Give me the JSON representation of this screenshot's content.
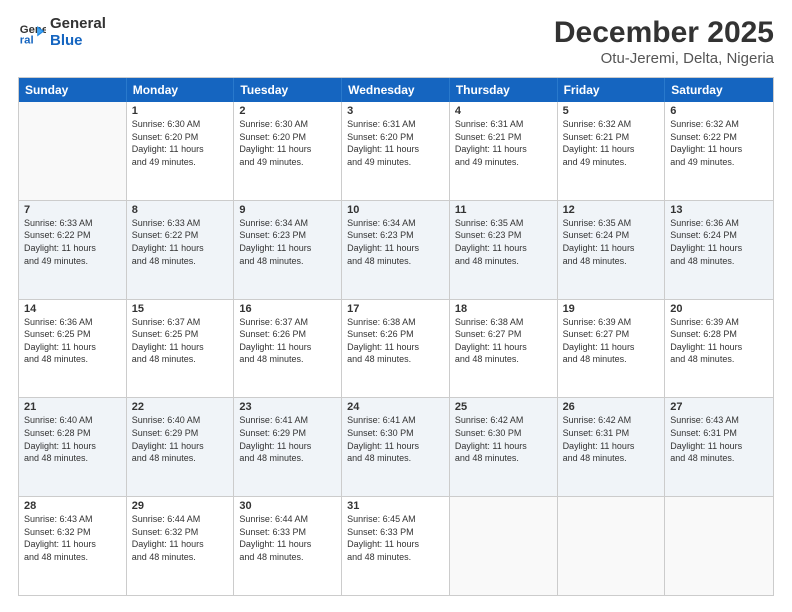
{
  "logo": {
    "text1": "General",
    "text2": "Blue"
  },
  "title": "December 2025",
  "subtitle": "Otu-Jeremi, Delta, Nigeria",
  "days": [
    "Sunday",
    "Monday",
    "Tuesday",
    "Wednesday",
    "Thursday",
    "Friday",
    "Saturday"
  ],
  "weeks": [
    [
      {
        "num": "",
        "lines": []
      },
      {
        "num": "1",
        "lines": [
          "Sunrise: 6:30 AM",
          "Sunset: 6:20 PM",
          "Daylight: 11 hours",
          "and 49 minutes."
        ]
      },
      {
        "num": "2",
        "lines": [
          "Sunrise: 6:30 AM",
          "Sunset: 6:20 PM",
          "Daylight: 11 hours",
          "and 49 minutes."
        ]
      },
      {
        "num": "3",
        "lines": [
          "Sunrise: 6:31 AM",
          "Sunset: 6:20 PM",
          "Daylight: 11 hours",
          "and 49 minutes."
        ]
      },
      {
        "num": "4",
        "lines": [
          "Sunrise: 6:31 AM",
          "Sunset: 6:21 PM",
          "Daylight: 11 hours",
          "and 49 minutes."
        ]
      },
      {
        "num": "5",
        "lines": [
          "Sunrise: 6:32 AM",
          "Sunset: 6:21 PM",
          "Daylight: 11 hours",
          "and 49 minutes."
        ]
      },
      {
        "num": "6",
        "lines": [
          "Sunrise: 6:32 AM",
          "Sunset: 6:22 PM",
          "Daylight: 11 hours",
          "and 49 minutes."
        ]
      }
    ],
    [
      {
        "num": "7",
        "lines": [
          "Sunrise: 6:33 AM",
          "Sunset: 6:22 PM",
          "Daylight: 11 hours",
          "and 49 minutes."
        ]
      },
      {
        "num": "8",
        "lines": [
          "Sunrise: 6:33 AM",
          "Sunset: 6:22 PM",
          "Daylight: 11 hours",
          "and 48 minutes."
        ]
      },
      {
        "num": "9",
        "lines": [
          "Sunrise: 6:34 AM",
          "Sunset: 6:23 PM",
          "Daylight: 11 hours",
          "and 48 minutes."
        ]
      },
      {
        "num": "10",
        "lines": [
          "Sunrise: 6:34 AM",
          "Sunset: 6:23 PM",
          "Daylight: 11 hours",
          "and 48 minutes."
        ]
      },
      {
        "num": "11",
        "lines": [
          "Sunrise: 6:35 AM",
          "Sunset: 6:23 PM",
          "Daylight: 11 hours",
          "and 48 minutes."
        ]
      },
      {
        "num": "12",
        "lines": [
          "Sunrise: 6:35 AM",
          "Sunset: 6:24 PM",
          "Daylight: 11 hours",
          "and 48 minutes."
        ]
      },
      {
        "num": "13",
        "lines": [
          "Sunrise: 6:36 AM",
          "Sunset: 6:24 PM",
          "Daylight: 11 hours",
          "and 48 minutes."
        ]
      }
    ],
    [
      {
        "num": "14",
        "lines": [
          "Sunrise: 6:36 AM",
          "Sunset: 6:25 PM",
          "Daylight: 11 hours",
          "and 48 minutes."
        ]
      },
      {
        "num": "15",
        "lines": [
          "Sunrise: 6:37 AM",
          "Sunset: 6:25 PM",
          "Daylight: 11 hours",
          "and 48 minutes."
        ]
      },
      {
        "num": "16",
        "lines": [
          "Sunrise: 6:37 AM",
          "Sunset: 6:26 PM",
          "Daylight: 11 hours",
          "and 48 minutes."
        ]
      },
      {
        "num": "17",
        "lines": [
          "Sunrise: 6:38 AM",
          "Sunset: 6:26 PM",
          "Daylight: 11 hours",
          "and 48 minutes."
        ]
      },
      {
        "num": "18",
        "lines": [
          "Sunrise: 6:38 AM",
          "Sunset: 6:27 PM",
          "Daylight: 11 hours",
          "and 48 minutes."
        ]
      },
      {
        "num": "19",
        "lines": [
          "Sunrise: 6:39 AM",
          "Sunset: 6:27 PM",
          "Daylight: 11 hours",
          "and 48 minutes."
        ]
      },
      {
        "num": "20",
        "lines": [
          "Sunrise: 6:39 AM",
          "Sunset: 6:28 PM",
          "Daylight: 11 hours",
          "and 48 minutes."
        ]
      }
    ],
    [
      {
        "num": "21",
        "lines": [
          "Sunrise: 6:40 AM",
          "Sunset: 6:28 PM",
          "Daylight: 11 hours",
          "and 48 minutes."
        ]
      },
      {
        "num": "22",
        "lines": [
          "Sunrise: 6:40 AM",
          "Sunset: 6:29 PM",
          "Daylight: 11 hours",
          "and 48 minutes."
        ]
      },
      {
        "num": "23",
        "lines": [
          "Sunrise: 6:41 AM",
          "Sunset: 6:29 PM",
          "Daylight: 11 hours",
          "and 48 minutes."
        ]
      },
      {
        "num": "24",
        "lines": [
          "Sunrise: 6:41 AM",
          "Sunset: 6:30 PM",
          "Daylight: 11 hours",
          "and 48 minutes."
        ]
      },
      {
        "num": "25",
        "lines": [
          "Sunrise: 6:42 AM",
          "Sunset: 6:30 PM",
          "Daylight: 11 hours",
          "and 48 minutes."
        ]
      },
      {
        "num": "26",
        "lines": [
          "Sunrise: 6:42 AM",
          "Sunset: 6:31 PM",
          "Daylight: 11 hours",
          "and 48 minutes."
        ]
      },
      {
        "num": "27",
        "lines": [
          "Sunrise: 6:43 AM",
          "Sunset: 6:31 PM",
          "Daylight: 11 hours",
          "and 48 minutes."
        ]
      }
    ],
    [
      {
        "num": "28",
        "lines": [
          "Sunrise: 6:43 AM",
          "Sunset: 6:32 PM",
          "Daylight: 11 hours",
          "and 48 minutes."
        ]
      },
      {
        "num": "29",
        "lines": [
          "Sunrise: 6:44 AM",
          "Sunset: 6:32 PM",
          "Daylight: 11 hours",
          "and 48 minutes."
        ]
      },
      {
        "num": "30",
        "lines": [
          "Sunrise: 6:44 AM",
          "Sunset: 6:33 PM",
          "Daylight: 11 hours",
          "and 48 minutes."
        ]
      },
      {
        "num": "31",
        "lines": [
          "Sunrise: 6:45 AM",
          "Sunset: 6:33 PM",
          "Daylight: 11 hours",
          "and 48 minutes."
        ]
      },
      {
        "num": "",
        "lines": []
      },
      {
        "num": "",
        "lines": []
      },
      {
        "num": "",
        "lines": []
      }
    ]
  ]
}
